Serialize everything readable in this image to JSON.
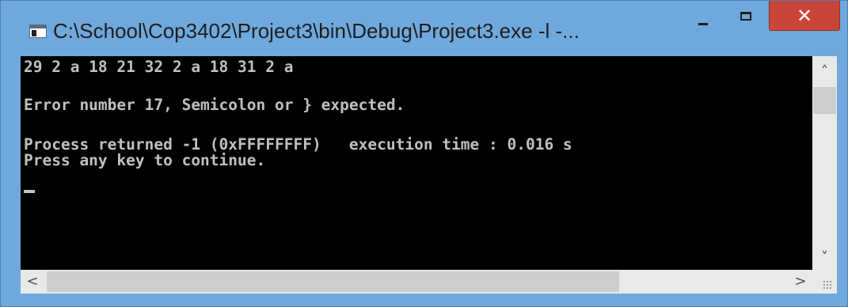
{
  "window": {
    "title": "C:\\School\\Cop3402\\Project3\\bin\\Debug\\Project3.exe -l -...",
    "close_glyph": "✕",
    "icons": {
      "app": "console-window-icon",
      "minimize": "minimize-icon",
      "maximize": "maximize-icon",
      "close": "close-icon"
    }
  },
  "console": {
    "lines": [
      "29 2 a 18 21 32 2 a 18 31 2 a",
      "",
      "Error number 17, Semicolon or } expected.",
      "",
      "Process returned -1 (0xFFFFFFFF)   execution time : 0.016 s",
      "Press any key to continue."
    ],
    "colors": {
      "background": "#000000",
      "text": "#c0c0c0"
    }
  },
  "scrollbars": {
    "up_arrow": "˄",
    "down_arrow": "˅",
    "left_arrow": "<",
    "right_arrow": ">"
  },
  "theme": {
    "frame": "#6fa8dc",
    "close_button": "#c9453a"
  }
}
